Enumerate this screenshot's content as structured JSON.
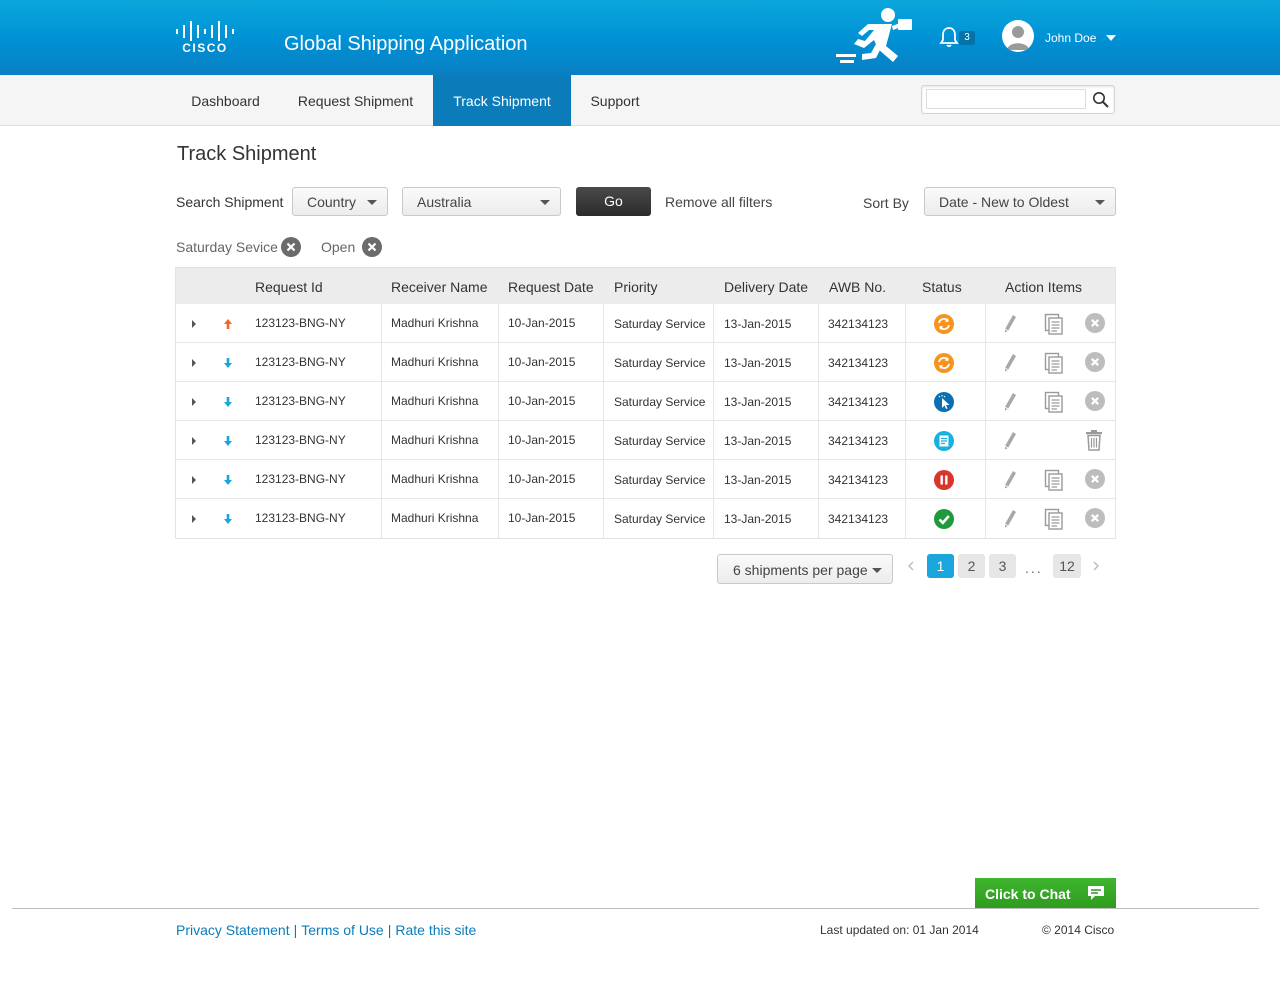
{
  "header": {
    "logo_text": "CISCO",
    "app_title": "Global Shipping Application",
    "notification_count": "3",
    "user_name": "John Doe"
  },
  "nav": {
    "items": [
      {
        "label": "Dashboard",
        "active": false
      },
      {
        "label": "Request Shipment",
        "active": false
      },
      {
        "label": "Track Shipment",
        "active": true
      },
      {
        "label": "Support",
        "active": false
      }
    ],
    "search_value": ""
  },
  "page": {
    "title": "Track Shipment",
    "search_label": "Search Shipment",
    "filter_field": "Country",
    "filter_value": "Australia",
    "go_label": "Go",
    "remove_filters_label": "Remove all filters",
    "sort_label": "Sort By",
    "sort_value": "Date - New to Oldest",
    "active_filters": [
      "Saturday Sevice",
      "Open"
    ]
  },
  "table": {
    "columns": [
      "Request Id",
      "Receiver Name",
      "Request Date",
      "Priority",
      "Delivery Date",
      "AWB No.",
      "Status",
      "Action Items"
    ],
    "rows": [
      {
        "direction": "up",
        "request_id": "123123-BNG-NY",
        "receiver": "Madhuri Krishna",
        "request_date": "10-Jan-2015",
        "priority": "Saturday Service",
        "delivery_date": "13-Jan-2015",
        "awb": "342134123",
        "status_icon": "sync-status-icon",
        "status_color": "#f7941e",
        "actions": [
          "edit",
          "copy",
          "cancel"
        ]
      },
      {
        "direction": "down",
        "request_id": "123123-BNG-NY",
        "receiver": "Madhuri Krishna",
        "request_date": "10-Jan-2015",
        "priority": "Saturday Service",
        "delivery_date": "13-Jan-2015",
        "awb": "342134123",
        "status_icon": "sync-status-icon",
        "status_color": "#f7941e",
        "actions": [
          "edit",
          "copy",
          "cancel"
        ]
      },
      {
        "direction": "down",
        "request_id": "123123-BNG-NY",
        "receiver": "Madhuri Krishna",
        "request_date": "10-Jan-2015",
        "priority": "Saturday Service",
        "delivery_date": "13-Jan-2015",
        "awb": "342134123",
        "status_icon": "pointer-status-icon",
        "status_color": "#0b6fb3",
        "actions": [
          "edit",
          "copy",
          "cancel"
        ]
      },
      {
        "direction": "down",
        "request_id": "123123-BNG-NY",
        "receiver": "Madhuri Krishna",
        "request_date": "10-Jan-2015",
        "priority": "Saturday Service",
        "delivery_date": "13-Jan-2015",
        "awb": "342134123",
        "status_icon": "document-status-icon",
        "status_color": "#17b1de",
        "actions": [
          "edit",
          "delete"
        ]
      },
      {
        "direction": "down",
        "request_id": "123123-BNG-NY",
        "receiver": "Madhuri Krishna",
        "request_date": "10-Jan-2015",
        "priority": "Saturday Service",
        "delivery_date": "13-Jan-2015",
        "awb": "342134123",
        "status_icon": "pause-status-icon",
        "status_color": "#d9352a",
        "actions": [
          "edit",
          "copy",
          "cancel"
        ]
      },
      {
        "direction": "down",
        "request_id": "123123-BNG-NY",
        "receiver": "Madhuri Krishna",
        "request_date": "10-Jan-2015",
        "priority": "Saturday Service",
        "delivery_date": "13-Jan-2015",
        "awb": "342134123",
        "status_icon": "check-status-icon",
        "status_color": "#1e9a3c",
        "actions": [
          "edit",
          "copy",
          "cancel"
        ]
      }
    ]
  },
  "pagination": {
    "per_page_label": "6 shipments per page",
    "pages": [
      "1",
      "2",
      "3"
    ],
    "ellipsis": "...",
    "last_page": "12",
    "current": "1"
  },
  "footer": {
    "chat_label": "Click to Chat",
    "links": [
      "Privacy Statement",
      "Terms of Use",
      "Rate this site"
    ],
    "last_updated": "Last updated on: 01 Jan 2014",
    "copyright": "© 2014 Cisco"
  },
  "colors": {
    "header_blue": "#0090d4",
    "active_tab": "#0b7cb9",
    "up_arrow": "#f26522",
    "down_arrow": "#1aa5dd",
    "chat_green": "#3fb52e"
  }
}
